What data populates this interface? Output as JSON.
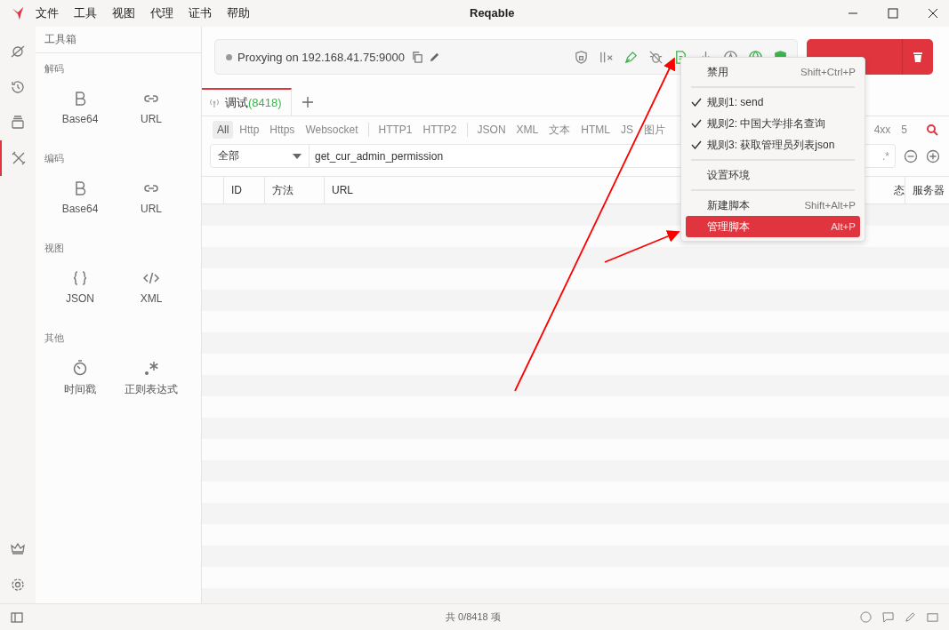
{
  "window": {
    "title": "Reqable"
  },
  "menu_bar": [
    "文件",
    "工具",
    "视图",
    "代理",
    "证书",
    "帮助"
  ],
  "rail": [
    {
      "selected": false
    },
    {
      "selected": false
    },
    {
      "selected": false
    },
    {
      "selected": true
    }
  ],
  "toolbox": {
    "title": "工具箱",
    "sections": [
      {
        "title": "解码",
        "tools": [
          {
            "label": "Base64",
            "kind": "b"
          },
          {
            "label": "URL",
            "kind": "link"
          }
        ]
      },
      {
        "title": "编码",
        "tools": [
          {
            "label": "Base64",
            "kind": "b"
          },
          {
            "label": "URL",
            "kind": "link"
          }
        ]
      },
      {
        "title": "视图",
        "tools": [
          {
            "label": "JSON",
            "kind": "braces"
          },
          {
            "label": "XML",
            "kind": "code"
          }
        ]
      },
      {
        "title": "其他",
        "tools": [
          {
            "label": "时间戳",
            "kind": "timer"
          },
          {
            "label": "正则表达式",
            "kind": "regex"
          }
        ]
      }
    ]
  },
  "proxy": {
    "status": "Proxying on 192.168.41.75:9000",
    "toolbar": [
      {
        "on": false
      },
      {
        "on": false
      },
      {
        "on": true
      },
      {
        "on": false
      },
      {
        "on": true
      },
      {
        "on": false
      },
      {
        "on": false
      },
      {
        "on": true
      },
      {
        "on": true
      }
    ]
  },
  "tabs": [
    {
      "label": "调试",
      "count": "(8418)",
      "selected": true
    }
  ],
  "filters": {
    "groups": [
      [
        {
          "label": "All",
          "selected": true
        },
        {
          "label": "Http",
          "selected": false
        },
        {
          "label": "Https",
          "selected": false
        },
        {
          "label": "Websocket",
          "selected": false
        }
      ],
      [
        {
          "label": "HTTP1",
          "selected": false
        },
        {
          "label": "HTTP2",
          "selected": false
        }
      ],
      [
        {
          "label": "JSON",
          "selected": false
        },
        {
          "label": "XML",
          "selected": false
        },
        {
          "label": "文本",
          "selected": false
        },
        {
          "label": "HTML",
          "selected": false
        },
        {
          "label": "JS",
          "selected": false
        },
        {
          "label": "图片",
          "selected": false
        }
      ]
    ],
    "right": [
      {
        "label": "4xx",
        "selected": false
      },
      {
        "label": "5",
        "selected": false
      }
    ]
  },
  "search": {
    "scope": "全部",
    "value": "get_cur_admin_permission",
    "regex": ".*"
  },
  "columns": [
    "ID",
    "方法",
    "URL",
    "态",
    "服务器"
  ],
  "context_menu": [
    {
      "kind": "item",
      "label": "禁用",
      "shortcut": "Shift+Ctrl+P",
      "selected": false
    },
    {
      "kind": "separator"
    },
    {
      "kind": "check",
      "label": "规则1: send",
      "checked": true,
      "selected": false
    },
    {
      "kind": "check",
      "label": "规则2: 中国大学排名查询",
      "checked": true,
      "selected": false
    },
    {
      "kind": "check",
      "label": "规则3: 获取管理员列表json",
      "checked": true,
      "selected": false
    },
    {
      "kind": "separator"
    },
    {
      "kind": "item",
      "label": "设置环境",
      "selected": false
    },
    {
      "kind": "separator"
    },
    {
      "kind": "item",
      "label": "新建脚本",
      "shortcut": "Shift+Alt+P",
      "selected": false
    },
    {
      "kind": "item",
      "label": "管理脚本",
      "shortcut": "Alt+P",
      "selected": true
    }
  ],
  "status_bar": {
    "text": "共 0/8418 项"
  }
}
